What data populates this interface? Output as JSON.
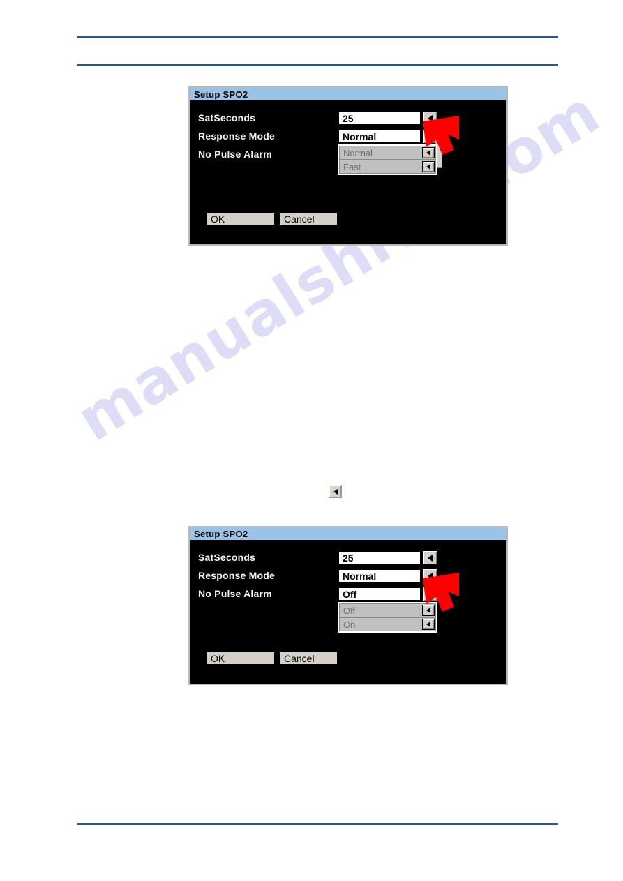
{
  "page": {
    "watermark_text": "manualshive.com",
    "rule_color": "#2b5786"
  },
  "inline_icon": {
    "name": "left-arrow-button-icon",
    "glyph": "◄"
  },
  "dialogs": [
    {
      "title": "Setup SPO2",
      "rows": [
        {
          "label": "SatSeconds",
          "value": "25"
        },
        {
          "label": "Response Mode",
          "value": "Normal"
        },
        {
          "label": "No Pulse Alarm",
          "value": ""
        }
      ],
      "open_dropdown": {
        "belongs_to": "Response Mode",
        "options": [
          "Normal",
          "Fast"
        ],
        "selected": "Normal"
      },
      "buttons": {
        "ok": "OK",
        "cancel": "Cancel"
      },
      "colors": {
        "titlebar": "#9bc3e6",
        "background": "#000000",
        "label_text": "#f2f2f2",
        "field_bg": "#ffffff",
        "list_bg": "#c0c0c0",
        "button_bg": "#d4d0c8",
        "pointer": "#ff0000"
      }
    },
    {
      "title": "Setup SPO2",
      "rows": [
        {
          "label": "SatSeconds",
          "value": "25"
        },
        {
          "label": "Response Mode",
          "value": "Normal"
        },
        {
          "label": "No Pulse Alarm",
          "value": "Off"
        }
      ],
      "open_dropdown": {
        "belongs_to": "No Pulse Alarm",
        "options": [
          "Off",
          "On"
        ],
        "selected": "Off"
      },
      "buttons": {
        "ok": "OK",
        "cancel": "Cancel"
      },
      "colors": {
        "titlebar": "#9bc3e6",
        "background": "#000000",
        "label_text": "#f2f2f2",
        "field_bg": "#ffffff",
        "list_bg": "#c0c0c0",
        "button_bg": "#d4d0c8",
        "pointer": "#ff0000"
      }
    }
  ]
}
